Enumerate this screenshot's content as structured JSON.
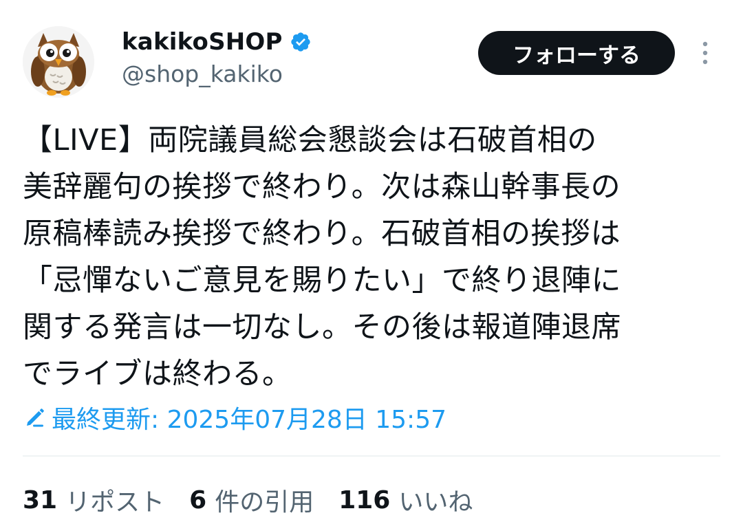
{
  "account": {
    "display_name": "kakikoSHOP",
    "handle": "@shop_kakiko",
    "avatar": "owl-avatar",
    "verified_icon": "verified-badge-icon",
    "verified_color": "#1d9bf0"
  },
  "follow_button": {
    "label": "フォローする"
  },
  "more_button": {
    "icon": "more-vertical-icon"
  },
  "tweet": {
    "text": "【LIVE】両院議員総会懇談会は石破首相の\n美辞麗句の挨拶で終わり。次は森山幹事長の\n原稿棒読み挨拶で終わり。石破首相の挨拶は\n「忌憚ないご意見を賜りたい」で終り退陣に\n関する発言は一切なし。その後は報道陣退席\nでライブは終わる。",
    "edited_icon": "pencil-icon",
    "edited_label": "最終更新: 2025年07月28日 15:57"
  },
  "stats": {
    "reposts_count": "31",
    "reposts_label": "リポスト",
    "quotes_count": "6",
    "quotes_label": "件の引用",
    "likes_count": "116",
    "likes_label": "いいね"
  },
  "colors": {
    "text": "#0f1419",
    "secondary": "#536471",
    "accent": "#1d9bf0",
    "button_bg": "#0f1419",
    "divider": "#eff3f4"
  }
}
